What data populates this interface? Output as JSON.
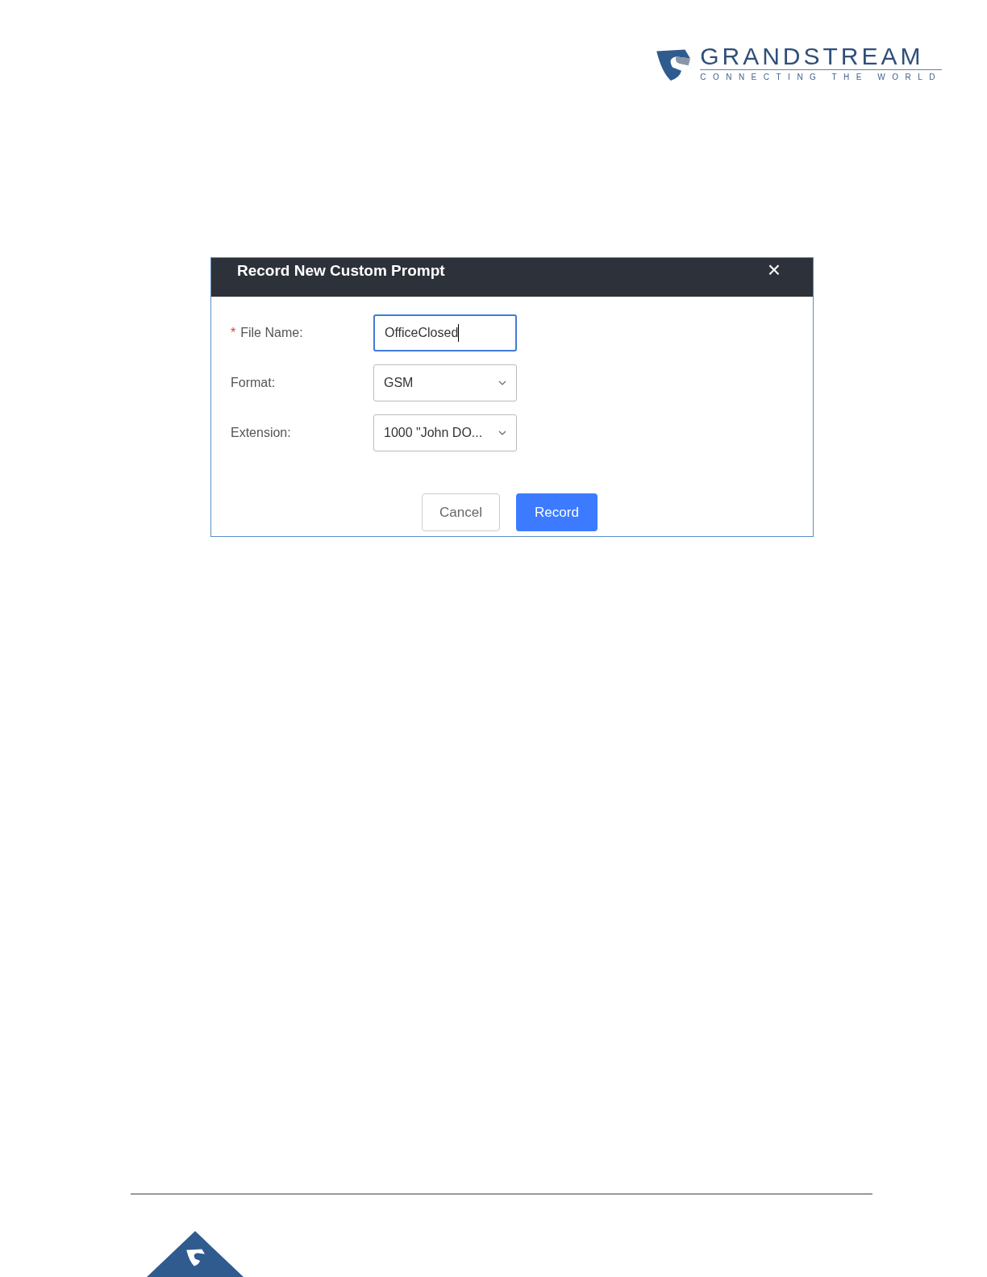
{
  "logo": {
    "name": "GRANDSTREAM",
    "tagline": "CONNECTING THE WORLD"
  },
  "dialog": {
    "title": "Record New Custom Prompt",
    "close": "×",
    "fields": [
      {
        "kind": "text",
        "label": "File Name:",
        "required_mark": "*",
        "value": "OfficeClosed",
        "focused": true
      },
      {
        "kind": "select",
        "label": "Format:",
        "value": "GSM",
        "focused": false
      },
      {
        "kind": "select",
        "label": "Extension:",
        "value": "1000 \"John DO...",
        "focused": false
      }
    ],
    "buttons": [
      {
        "kind": "secondary",
        "label": "Cancel"
      },
      {
        "kind": "primary",
        "label": "Record"
      }
    ]
  }
}
